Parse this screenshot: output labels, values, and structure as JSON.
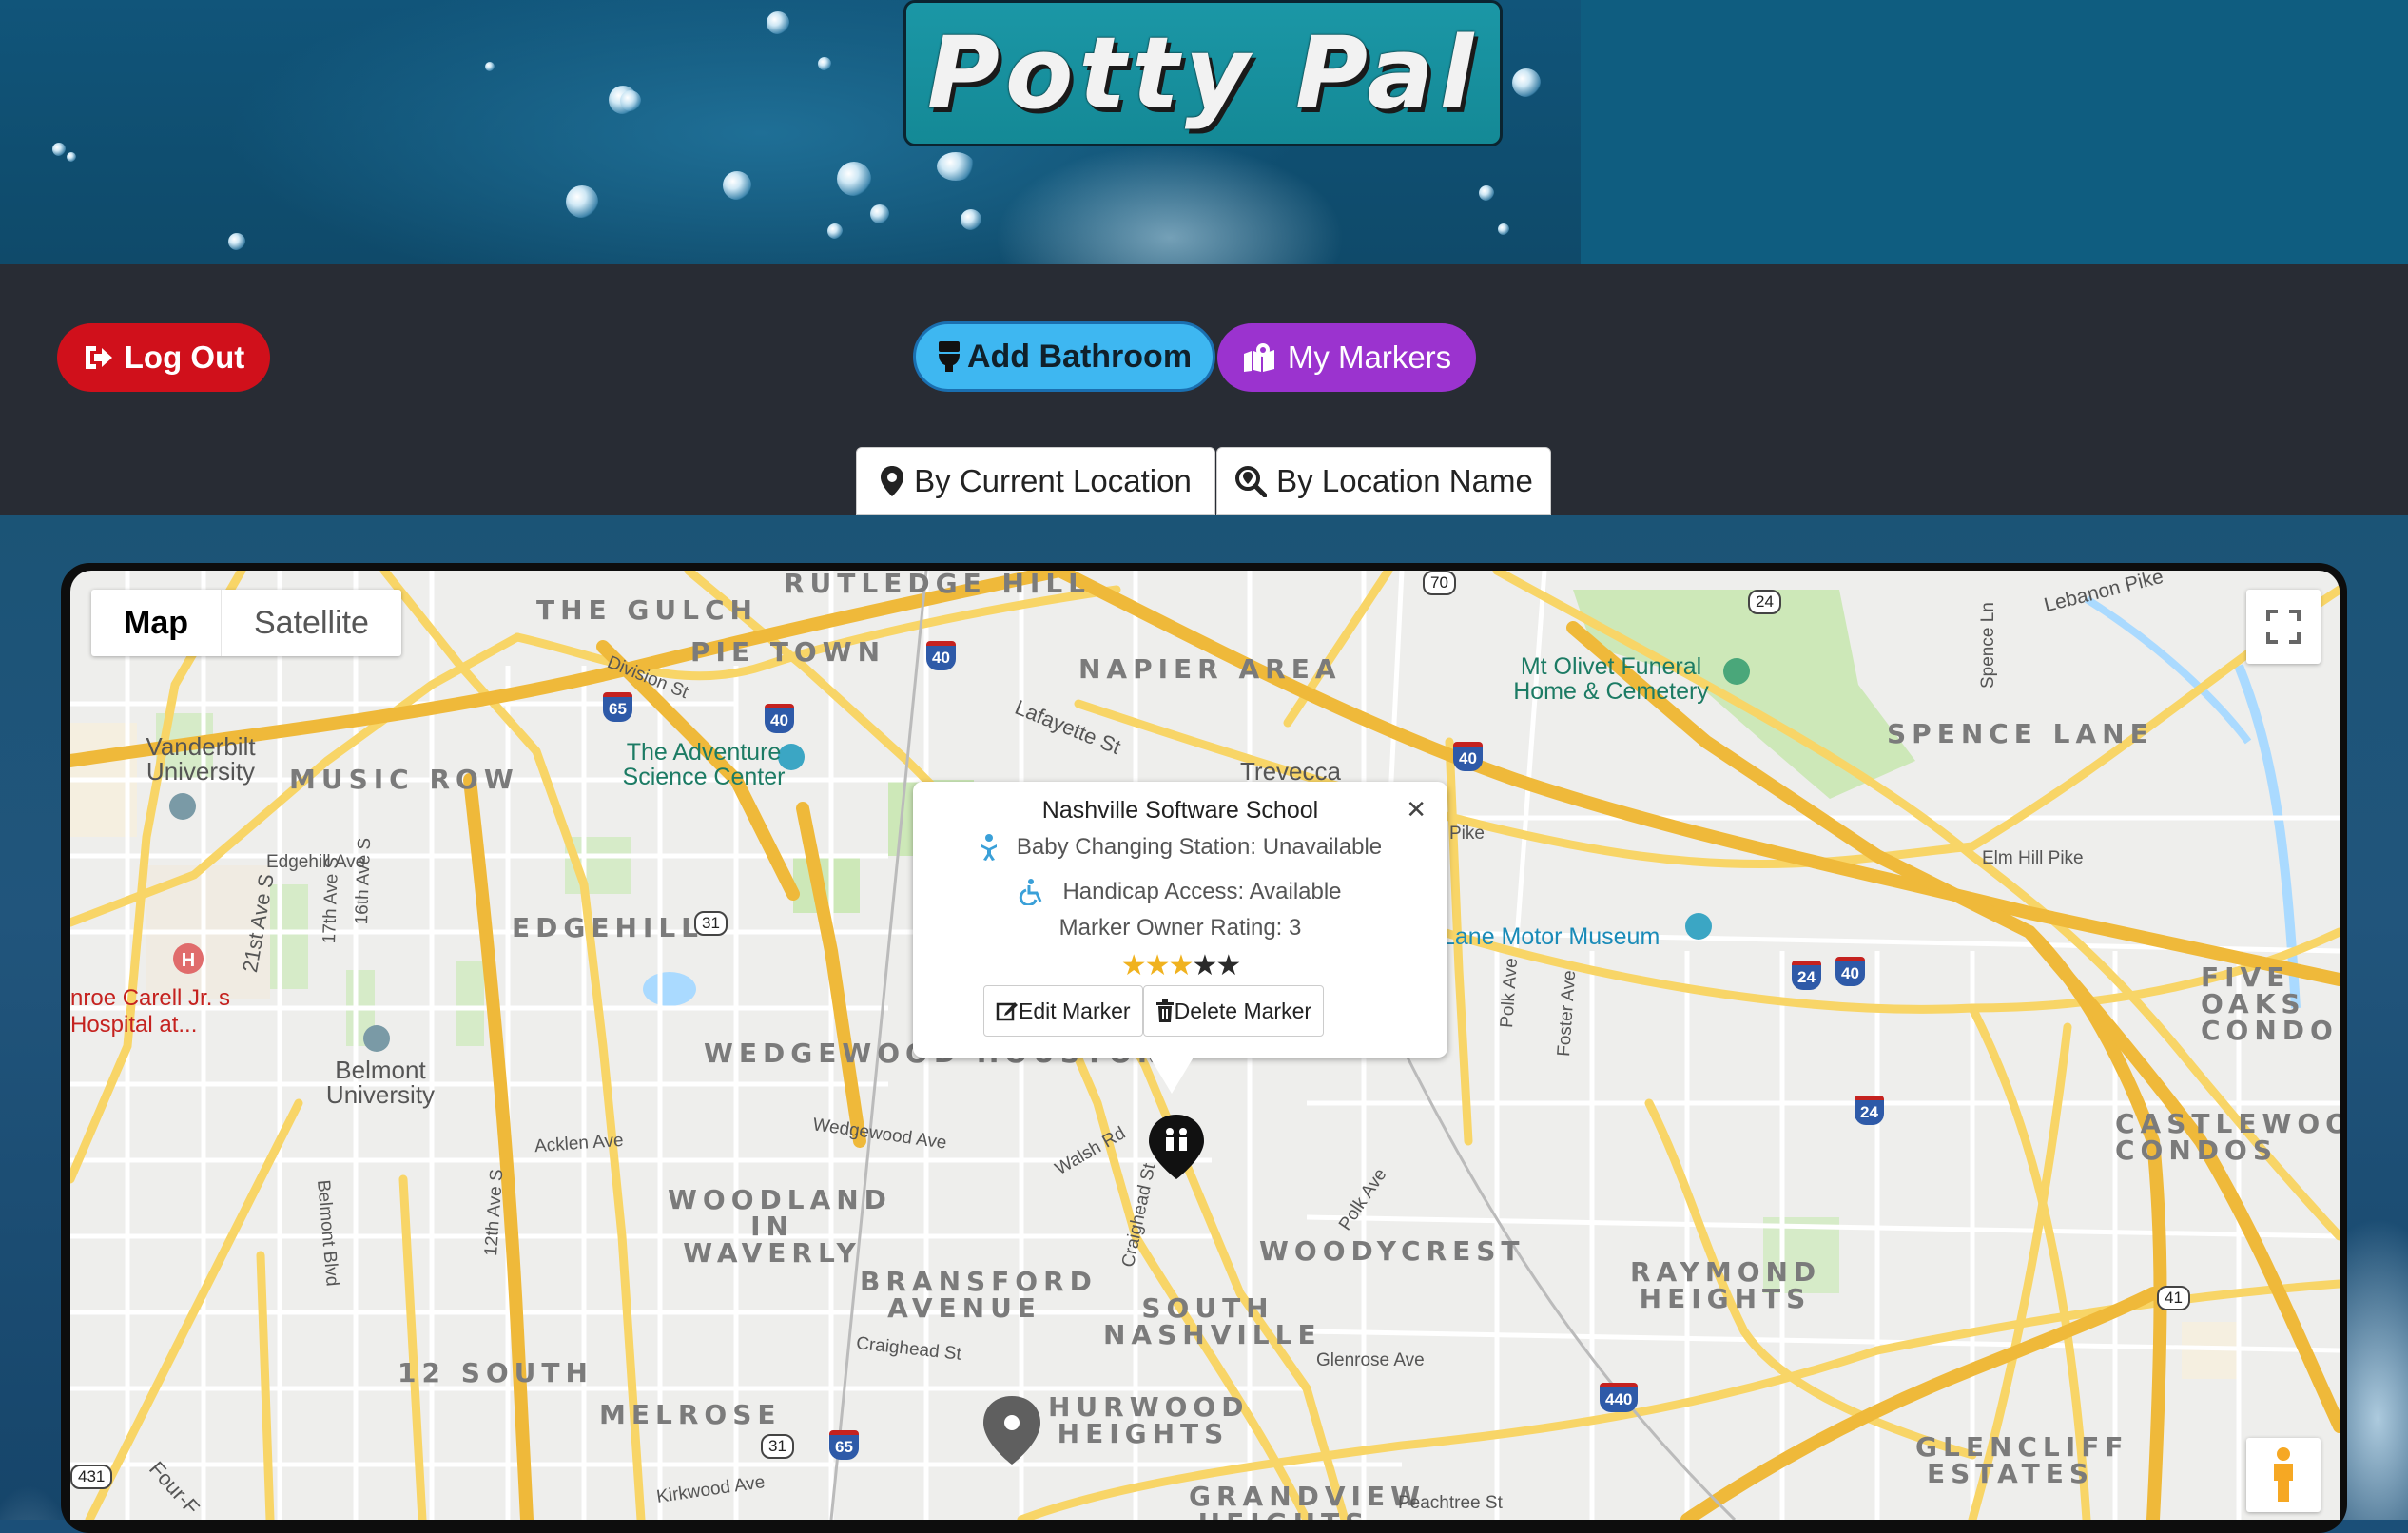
{
  "header": {
    "title": "Potty Pal"
  },
  "nav": {
    "logout_label": "Log Out",
    "add_label": "Add Bathroom",
    "markers_label": "My Markers",
    "current_location_label": "By Current Location",
    "location_name_label": "By Location Name"
  },
  "map": {
    "type_map": "Map",
    "type_satellite": "Satellite",
    "areas": [
      "RUTLEDGE HILL",
      "THE GULCH",
      "PIE TOWN",
      "NAPIER AREA",
      "MUSIC ROW",
      "EDGEHILL",
      "SPENCE LANE",
      "WEDGEWOOD HOUSTON",
      "WOODLAND IN WAVERLY",
      "BRANSFORD AVENUE",
      "SOUTH NASHVILLE",
      "WOODYCREST",
      "RAYMOND HEIGHTS",
      "12 SOUTH",
      "MELROSE",
      "HURWOOD HEIGHTS",
      "GRANDVIEW HEIGHTS",
      "GLENCLIFF ESTATES",
      "FIVE OAKS CONDOS",
      "CASTLEWOOD CONDOS"
    ],
    "pois": {
      "vanderbilt": "Vanderbilt University",
      "adventure": "The Adventure Science Center",
      "olivet": "Mt Olivet Funeral Home & Cemetery",
      "trevecca": "Trevecca",
      "belmont": "Belmont University",
      "lane_motor": "Lane Motor Museum",
      "carell": "nroe Carell Jr. s Hospital at..."
    },
    "streets": {
      "division": "Division St",
      "lafayette": "Lafayette St",
      "edgehill": "Edgehill Ave",
      "ave17": "17th Ave S",
      "ave16": "16th Ave S",
      "ave21": "21st Ave S",
      "pike": "Pike",
      "elmhill": "Elm Hill Pike",
      "lebanon": "Lebanon Pike",
      "spence": "Spence Ln",
      "polk": "Polk Ave",
      "foster": "Foster Ave",
      "acklen": "Acklen Ave",
      "wedgewood": "Wedgewood Ave",
      "walsh": "Walsh Rd",
      "belmontblvd": "Belmont Blvd",
      "ave12": "12th Ave S",
      "craighead": "Craighead St",
      "craighead2": "Craighead St",
      "glenrose": "Glenrose Ave",
      "polk2": "Polk Ave",
      "kirkwood": "Kirkwood Ave",
      "peachtree": "Peachtree St",
      "fourf": "Four-F"
    }
  },
  "info_window": {
    "title": "Nashville Software School",
    "baby_changing": "Baby Changing Station: Unavailable",
    "handicap": "Handicap Access: Available",
    "rating_text": "Marker Owner Rating: 3",
    "rating": 3,
    "rating_max": 5,
    "edit_label": "Edit Marker",
    "delete_label": "Delete Marker"
  },
  "colors": {
    "logout": "#d0101b",
    "add": "#3eb7f1",
    "markers": "#9b33cf",
    "navbar": "#282c34",
    "title_box": "#1b97a6"
  }
}
